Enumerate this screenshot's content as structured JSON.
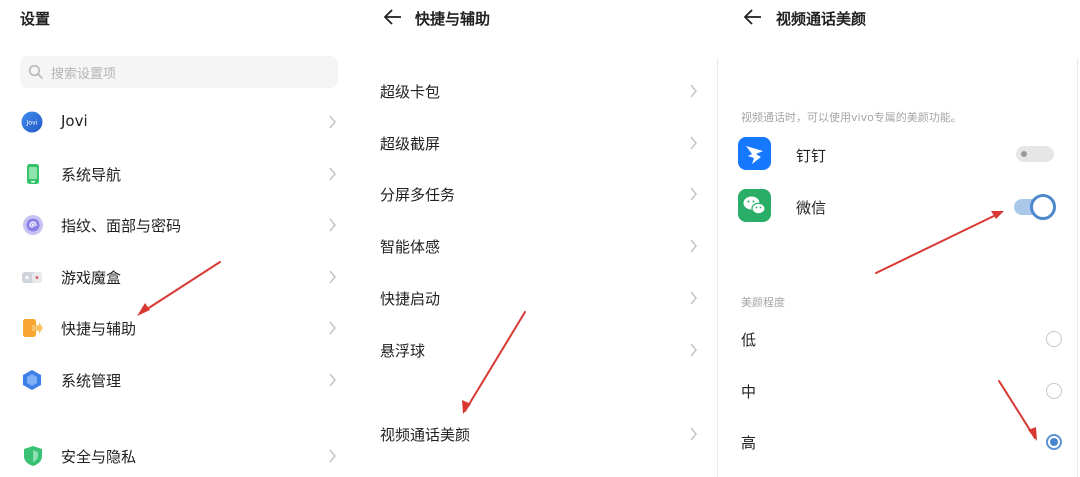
{
  "settings": {
    "title": "设置",
    "search_placeholder": "搜索设置项",
    "items": [
      {
        "label": "Jovi"
      },
      {
        "label": "系统导航"
      },
      {
        "label": "指纹、面部与密码"
      },
      {
        "label": "游戏魔盒"
      },
      {
        "label": "快捷与辅助"
      },
      {
        "label": "系统管理"
      },
      {
        "label": "安全与隐私"
      }
    ],
    "jovi_icon_text": "Jovi"
  },
  "shortcuts": {
    "title": "快捷与辅助",
    "items": [
      {
        "label": "超级卡包"
      },
      {
        "label": "超级截屏"
      },
      {
        "label": "分屏多任务"
      },
      {
        "label": "智能体感"
      },
      {
        "label": "快捷启动"
      },
      {
        "label": "悬浮球"
      },
      {
        "label": "视频通话美颜"
      }
    ]
  },
  "beauty": {
    "title": "视频通话美颜",
    "description": "视频通话时，可以使用vivo专属的美颜功能。",
    "apps": [
      {
        "label": "钉钉",
        "enabled": false,
        "icon": "dingtalk-icon"
      },
      {
        "label": "微信",
        "enabled": true,
        "icon": "wechat-icon"
      }
    ],
    "level_section": "美颜程度",
    "levels": [
      {
        "label": "低",
        "selected": false
      },
      {
        "label": "中",
        "selected": false
      },
      {
        "label": "高",
        "selected": true
      }
    ]
  },
  "colors": {
    "accent_blue": "#4a86cf",
    "annotation_red": "#d83a33",
    "wechat_green": "#2aae67",
    "dingtalk_blue": "#1677ff"
  }
}
